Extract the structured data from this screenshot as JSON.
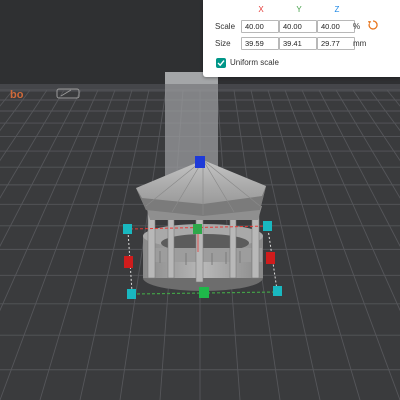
{
  "scale_panel": {
    "axes": [
      "X",
      "Y",
      "Z"
    ],
    "axis_colors": [
      "#e53935",
      "#43a047",
      "#1e88e5"
    ],
    "scale_label": "Scale",
    "size_label": "Size",
    "scale_values": [
      "40.00",
      "40.00",
      "40.00"
    ],
    "size_values": [
      "39.59",
      "39.41",
      "29.77"
    ],
    "scale_unit": "%",
    "size_unit": "mm",
    "uniform_scale_label": "Uniform scale",
    "uniform_scale_checked": true,
    "reset_icon": "reset-icon"
  },
  "viewport": {
    "plate_logo_text": "bo",
    "accent": "#009688"
  }
}
